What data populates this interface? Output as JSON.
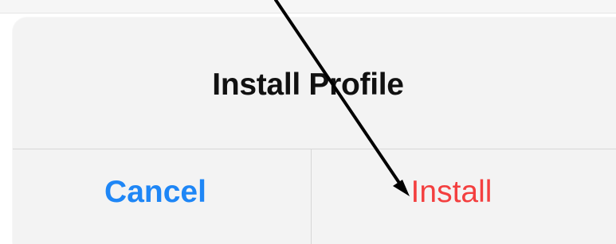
{
  "dialog": {
    "title": "Install Profile",
    "buttons": {
      "cancel": "Cancel",
      "install": "Install"
    }
  },
  "colors": {
    "cancel": "#1e86f6",
    "install": "#f33f3f",
    "title": "#111111",
    "panel": "#f3f3f3",
    "divider": "#d7d7d7",
    "arrow": "#000000"
  },
  "icons": {
    "pointer": "arrow-icon"
  }
}
